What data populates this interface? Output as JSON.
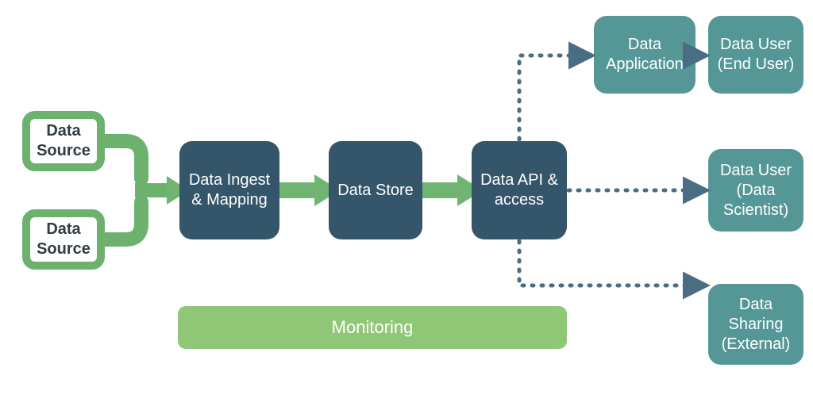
{
  "nodes": {
    "source1": "Data Source",
    "source2": "Data Source",
    "ingest": "Data Ingest & Mapping",
    "store": "Data Store",
    "api": "Data API & access",
    "app": "Data Application",
    "user_end": "Data User (End User)",
    "user_sci": "Data User (Data Scientist)",
    "sharing": "Data Sharing (External)"
  },
  "monitoring_label": "Monitoring",
  "colors": {
    "dark": "#35556a",
    "teal": "#559797",
    "green_border": "#6cb16e",
    "green_arrow": "#6fb571",
    "monitor": "#90c776",
    "dotted": "#4a6d83"
  }
}
